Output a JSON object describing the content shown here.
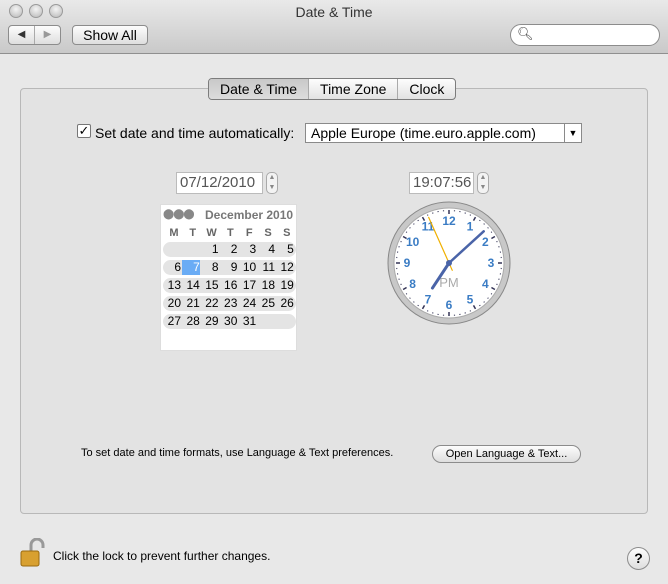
{
  "window": {
    "title": "Date & Time"
  },
  "toolbar": {
    "back": "◀",
    "forward": "▶",
    "show_all": "Show All",
    "search_placeholder": ""
  },
  "tabs": [
    {
      "label": "Date & Time",
      "selected": true
    },
    {
      "label": "Time Zone",
      "selected": false
    },
    {
      "label": "Clock",
      "selected": false
    }
  ],
  "auto": {
    "checked": true,
    "check_mark": "✓",
    "label": "Set date and time automatically:",
    "server": "Apple Europe (time.euro.apple.com)"
  },
  "date_field": "07/12/2010",
  "time_field": "19:07:56",
  "calendar": {
    "month_label": "December 2010",
    "weekdays": [
      "M",
      "T",
      "W",
      "T",
      "F",
      "S",
      "S"
    ],
    "weeks": [
      [
        "",
        "",
        "1",
        "2",
        "3",
        "4",
        "5"
      ],
      [
        "6",
        "7",
        "8",
        "9",
        "10",
        "11",
        "12"
      ],
      [
        "13",
        "14",
        "15",
        "16",
        "17",
        "18",
        "19"
      ],
      [
        "20",
        "21",
        "22",
        "23",
        "24",
        "25",
        "26"
      ],
      [
        "27",
        "28",
        "29",
        "30",
        "31",
        "",
        ""
      ]
    ],
    "selected_day": "7",
    "selected_color": "#6aacf5"
  },
  "clock": {
    "numbers": [
      "12",
      "1",
      "2",
      "3",
      "4",
      "5",
      "6",
      "7",
      "8",
      "9",
      "10",
      "11"
    ],
    "ampm": "PM",
    "time": {
      "h": 19,
      "m": 7,
      "s": 56
    },
    "number_color": "#3a7cc4",
    "hand_color": "#4a64a8",
    "second_hand_color": "#f0b000"
  },
  "footnote": "To set date and time formats, use Language & Text preferences.",
  "open_language_button": "Open Language & Text...",
  "lock_text": "Click the lock to prevent further changes.",
  "help": "?"
}
